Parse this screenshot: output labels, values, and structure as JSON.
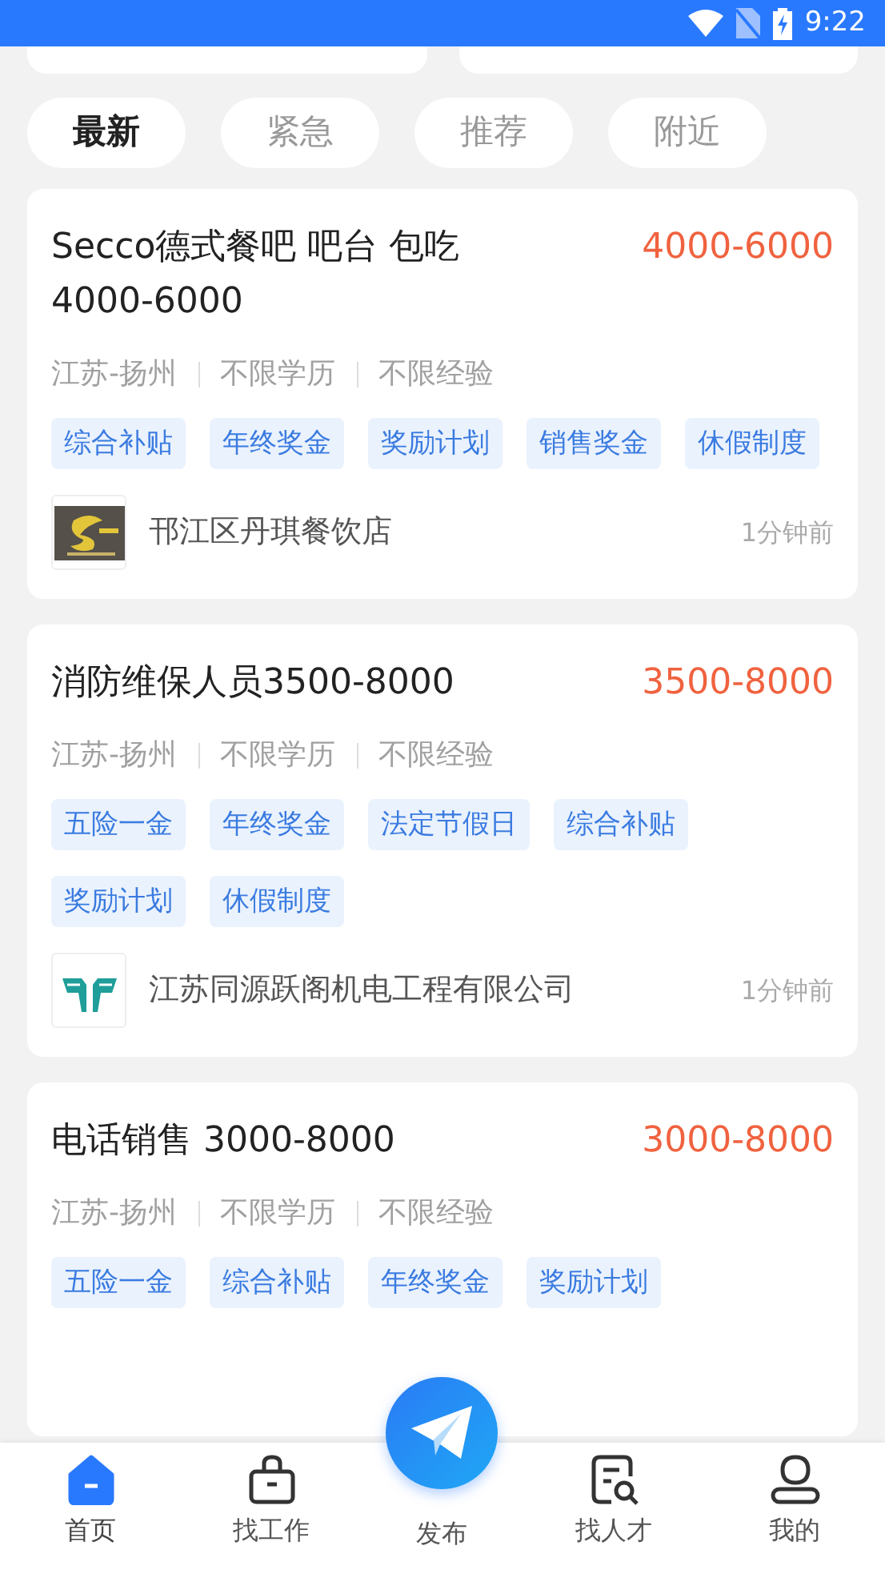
{
  "status_bar": {
    "time": "9:22"
  },
  "filter_tabs": [
    {
      "label": "最新",
      "selected": true
    },
    {
      "label": "紧急",
      "selected": false
    },
    {
      "label": "推荐",
      "selected": false
    },
    {
      "label": "附近",
      "selected": false
    }
  ],
  "jobs": [
    {
      "title": "Secco德式餐吧 吧台 包吃 4000-6000",
      "salary": "4000-6000",
      "meta": [
        "江苏-扬州",
        "不限学历",
        "不限经验"
      ],
      "tags": [
        "综合补贴",
        "年终奖金",
        "奖励计划",
        "销售奖金",
        "休假制度"
      ],
      "company": {
        "name": "邗江区丹琪餐饮店",
        "posted": "1分钟前",
        "kind": "dark"
      }
    },
    {
      "title": "消防维保人员3500-8000",
      "salary": "3500-8000",
      "meta": [
        "江苏-扬州",
        "不限学历",
        "不限经验"
      ],
      "tags": [
        "五险一金",
        "年终奖金",
        "法定节假日",
        "综合补贴",
        "奖励计划",
        "休假制度"
      ],
      "company": {
        "name": "江苏同源跃阁机电工程有限公司",
        "posted": "1分钟前",
        "kind": "teal"
      }
    },
    {
      "title": "电话销售 3000-8000",
      "salary": "3000-8000",
      "meta": [
        "江苏-扬州",
        "不限学历",
        "不限经验"
      ],
      "tags": [
        "五险一金",
        "综合补贴",
        "年终奖金",
        "奖励计划"
      ]
    }
  ],
  "nav": [
    {
      "label": "首页",
      "selected": true
    },
    {
      "label": "找工作",
      "selected": false
    },
    {
      "label": "发布",
      "kind": "fab"
    },
    {
      "label": "找人才",
      "selected": false
    },
    {
      "label": "我的",
      "selected": false
    }
  ]
}
